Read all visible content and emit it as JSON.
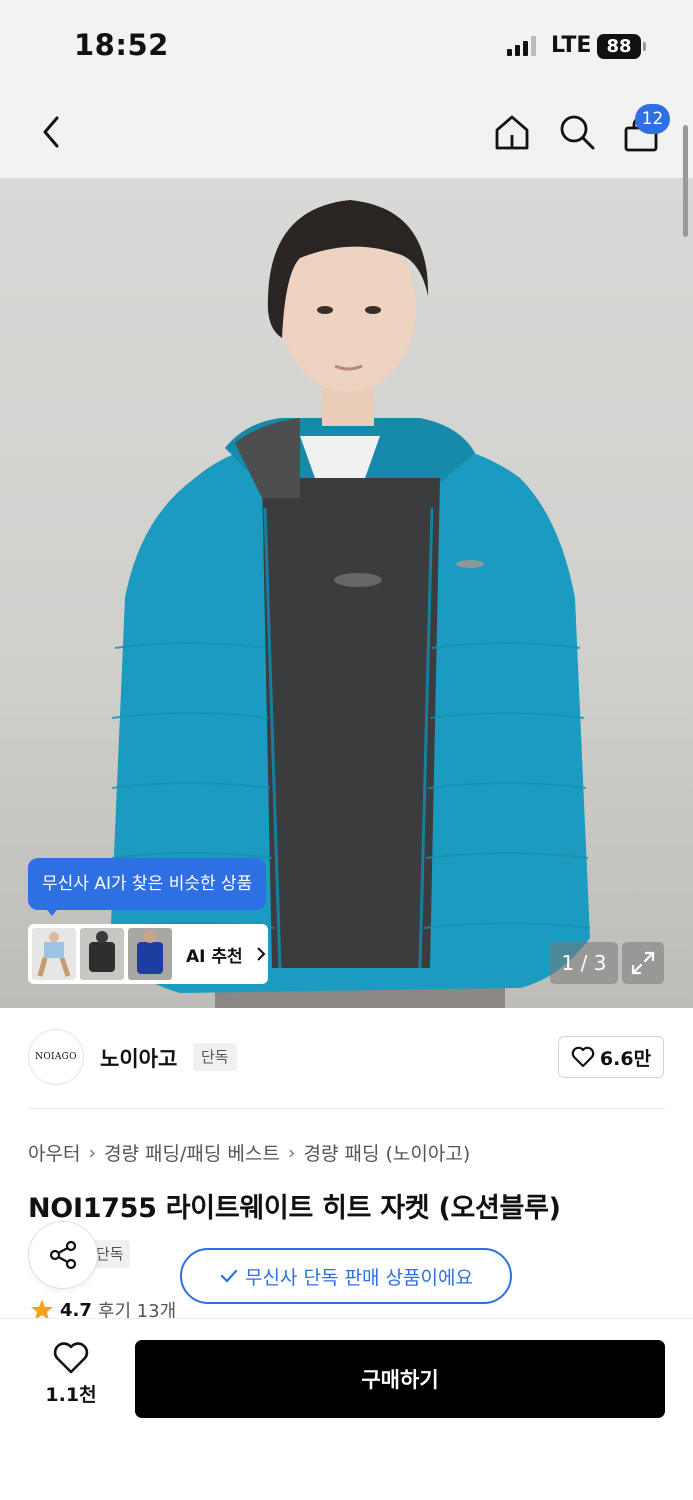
{
  "status_bar": {
    "time": "18:52",
    "network": "LTE",
    "battery": "88"
  },
  "nav": {
    "cart_count": "12",
    "icons": [
      "back-icon",
      "home-icon",
      "search-icon",
      "cart-icon"
    ]
  },
  "gallery": {
    "counter": "1 / 3",
    "ai_bubble": "무신사 AI가 찾은 비슷한 상품",
    "ai_rec_label": "AI 추천",
    "jacket_color": "#1a9bbf"
  },
  "brand": {
    "logo_text": "NOIAGO",
    "name": "노이아고",
    "tag": "단독",
    "likes": "6.6만"
  },
  "product": {
    "breadcrumb": [
      "아우터",
      "경량 패딩/패딩 베스트",
      "경량 패딩 (노이아고)"
    ],
    "title": "NOI1755 라이트웨이트 히트 자켓 (오션블루)",
    "exclusive_tag": "단독",
    "exclusive_notice": "무신사 단독 판매 상품이에요",
    "rating": "4.7",
    "reviews": "후기 13개"
  },
  "bottom": {
    "wish_count": "1.1천",
    "buy_label": "구매하기"
  },
  "colors": {
    "accent": "#2f6fe4",
    "buy_button": "#000000"
  }
}
